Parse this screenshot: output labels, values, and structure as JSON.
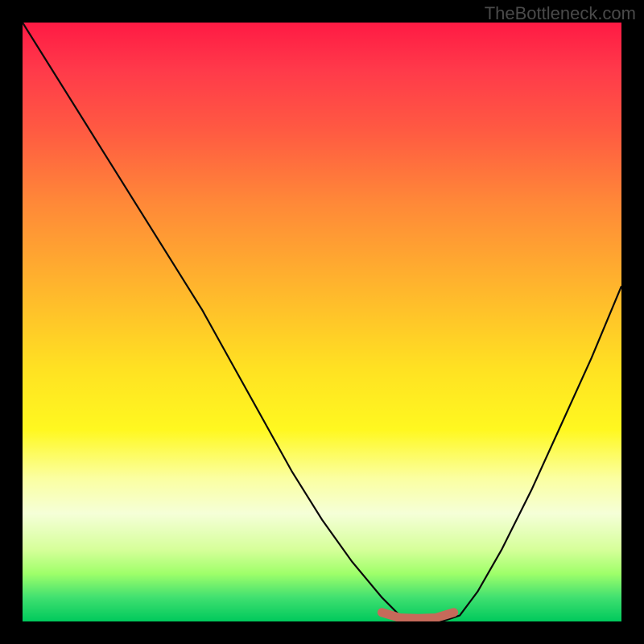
{
  "watermark": "TheBottleneck.com",
  "chart_data": {
    "type": "line",
    "title": "",
    "xlabel": "",
    "ylabel": "",
    "xlim": [
      0,
      100
    ],
    "ylim": [
      0,
      100
    ],
    "series": [
      {
        "name": "bottleneck-curve",
        "x": [
          0,
          5,
          10,
          15,
          20,
          25,
          30,
          35,
          40,
          45,
          50,
          55,
          60,
          63,
          66,
          70,
          73,
          76,
          80,
          85,
          90,
          95,
          100
        ],
        "values": [
          100,
          92,
          84,
          76,
          68,
          60,
          52,
          43,
          34,
          25,
          17,
          10,
          4,
          1,
          0,
          0,
          1,
          5,
          12,
          22,
          33,
          44,
          56
        ],
        "color": "#0a0a0a"
      },
      {
        "name": "optimal-range-marker",
        "x": [
          60,
          63,
          66,
          69,
          72
        ],
        "values": [
          1.5,
          0.6,
          0.5,
          0.6,
          1.5
        ],
        "color": "#c66a5a"
      }
    ],
    "gradient_stops": [
      {
        "pos": 0,
        "color": "#ff1a44"
      },
      {
        "pos": 8,
        "color": "#ff3a4a"
      },
      {
        "pos": 18,
        "color": "#ff5a42"
      },
      {
        "pos": 30,
        "color": "#ff8838"
      },
      {
        "pos": 45,
        "color": "#ffb82c"
      },
      {
        "pos": 58,
        "color": "#ffe222"
      },
      {
        "pos": 68,
        "color": "#fff820"
      },
      {
        "pos": 76,
        "color": "#fbffa0"
      },
      {
        "pos": 82,
        "color": "#f5ffd8"
      },
      {
        "pos": 88,
        "color": "#d6ff9a"
      },
      {
        "pos": 92,
        "color": "#9fff6a"
      },
      {
        "pos": 96,
        "color": "#40e070"
      },
      {
        "pos": 100,
        "color": "#00c95c"
      }
    ]
  }
}
